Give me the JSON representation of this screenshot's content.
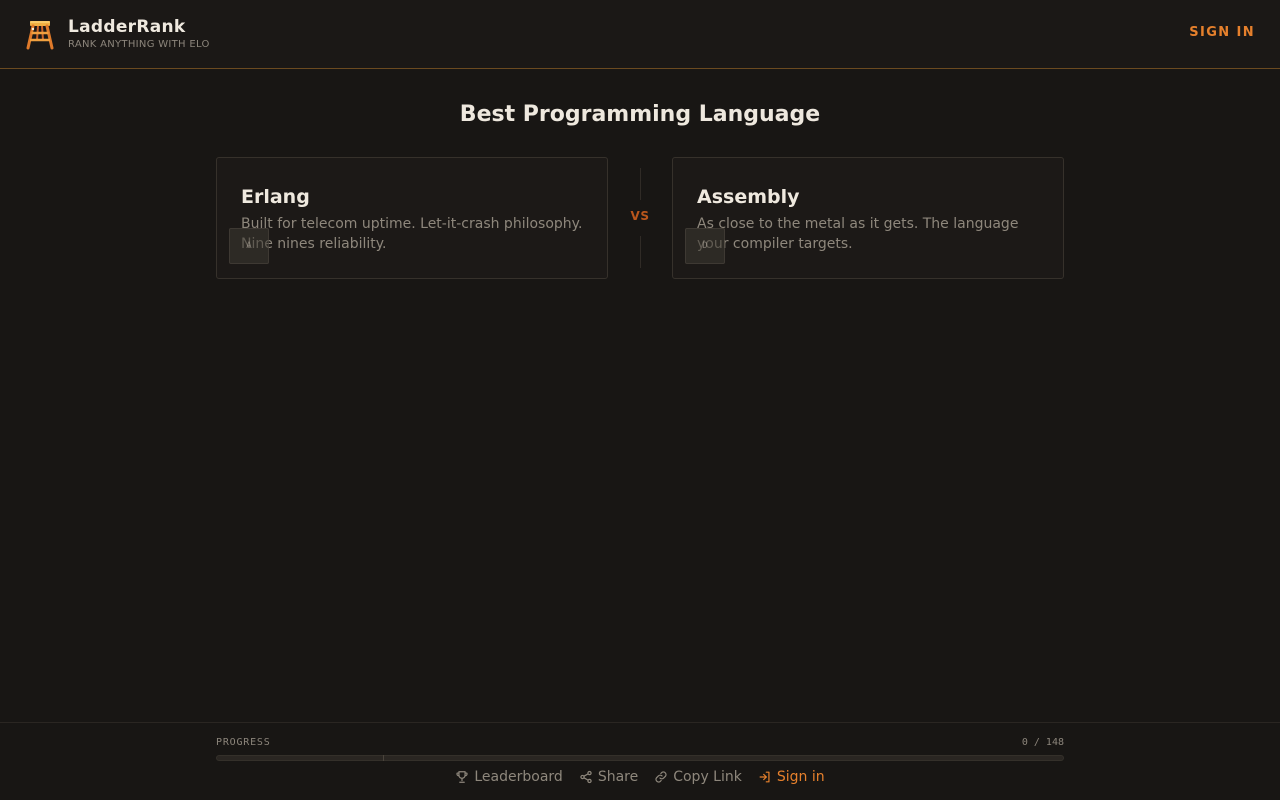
{
  "header": {
    "brand_name": "LadderRank",
    "tagline": "RANK ANYTHING WITH ELO",
    "sign_in_label": "SIGN IN"
  },
  "main": {
    "title": "Best Programming Language",
    "vs_label": "VS",
    "left_card": {
      "title": "Erlang",
      "description": "Built for telecom uptime. Let-it-crash philosophy. Nine nines reliability.",
      "key_hint": "A"
    },
    "right_card": {
      "title": "Assembly",
      "description": "As close to the metal as it gets. The language your compiler targets.",
      "key_hint": "D"
    }
  },
  "footer": {
    "progress_label": "PROGRESS",
    "progress_count": "0 / 148",
    "progress_value": 0,
    "progress_total": 148,
    "links": {
      "leaderboard": "Leaderboard",
      "share": "Share",
      "copy_link": "Copy Link",
      "sign_in": "Sign in"
    }
  },
  "colors": {
    "background": "#181614",
    "accent": "#e6802c",
    "vs": "#b9561c",
    "muted_text": "#8e877c"
  },
  "icons": {
    "logo": "ladder-logo-icon",
    "leaderboard": "trophy-icon",
    "share": "share-icon",
    "copy_link": "link-icon",
    "sign_in": "sign-in-icon"
  }
}
